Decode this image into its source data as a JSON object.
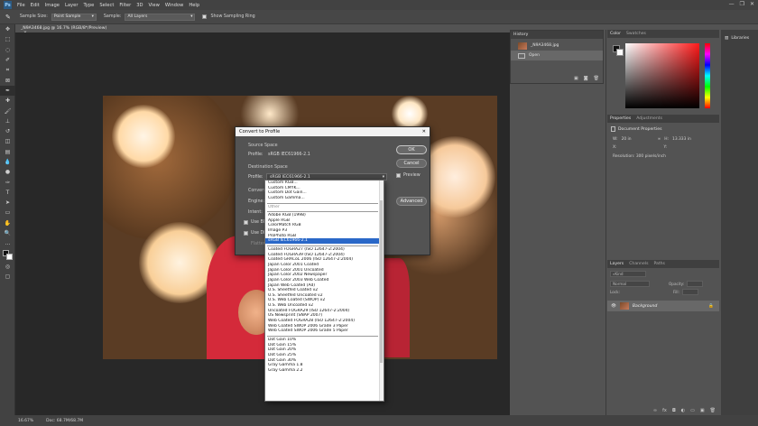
{
  "menubar": {
    "logo": "Ps",
    "items": [
      "File",
      "Edit",
      "Image",
      "Layer",
      "Type",
      "Select",
      "Filter",
      "3D",
      "View",
      "Window",
      "Help"
    ],
    "window_controls": [
      "—",
      "❐",
      "✕"
    ]
  },
  "options": {
    "sample_size_label": "Sample Size:",
    "sample_size_value": "Point Sample",
    "sample_label": "Sample:",
    "sample_value": "All Layers",
    "show_ring_label": "Show Sampling Ring"
  },
  "document": {
    "tab_title": "_N9A3468.jpg @ 16.7% (RGB/8*/Preview)",
    "tab_close": "×"
  },
  "status": {
    "zoom": "16.67%",
    "doc_info": "Doc: 68.7M/68.7M"
  },
  "history": {
    "tab": "History",
    "snapshot_name": "_N9A3468.jpg",
    "state": "Open"
  },
  "color_panel": {
    "tabs": [
      "Color",
      "Swatches"
    ]
  },
  "libraries": {
    "label": "Libraries"
  },
  "properties": {
    "tabs": [
      "Properties",
      "Adjustments"
    ],
    "heading": "Document Properties",
    "w_label": "W:",
    "w_value": "20 in",
    "h_label": "H:",
    "h_value": "13.333 in",
    "x_label": "X:",
    "y_label": "Y:",
    "resolution": "Resolution: 300 pixels/inch"
  },
  "layers": {
    "tabs": [
      "Layers",
      "Channels",
      "Paths"
    ],
    "kind_placeholder": "Kind",
    "blend_mode": "Normal",
    "opacity_label": "Opacity:",
    "lock_label": "Lock:",
    "fill_label": "Fill:",
    "layer_name": "Background"
  },
  "dialog": {
    "title": "Convert to Profile",
    "close": "✕",
    "source_space_label": "Source Space",
    "source_profile_label": "Profile:",
    "source_profile_value": "sRGB IEC61966-2.1",
    "destination_space_label": "Destination Space",
    "dest_profile_label": "Profile:",
    "dest_profile_value": "sRGB IEC61966-2.1",
    "conversion_label": "Convers",
    "engine_label": "Engine:",
    "intent_label": "Intent:",
    "use_bp_label": "Use Bl",
    "use_dither_label": "Use Di",
    "flatten_label": "Flatten",
    "ok": "OK",
    "cancel": "Cancel",
    "preview": "Preview",
    "advanced": "Advanced"
  },
  "dropdown": {
    "group1": [
      "Custom RGB...",
      "Custom CMYK...",
      "Custom Dot Gain...",
      "Custom Gamma..."
    ],
    "group2": [
      "Other"
    ],
    "group3": [
      "Adobe RGB (1998)",
      "Apple RGB",
      "ColorMatch RGB",
      "Image P3",
      "ProPhoto RGB",
      "sRGB IEC61966-2.1"
    ],
    "selected_index": 5,
    "group4": [
      "Coated FOGRA27 (ISO 12647-2:2004)",
      "Coated FOGRA39 (ISO 12647-2:2004)",
      "Coated GRACoL 2006 (ISO 12647-2:2004)",
      "Japan Color 2001 Coated",
      "Japan Color 2001 Uncoated",
      "Japan Color 2002 Newspaper",
      "Japan Color 2003 Web Coated",
      "Japan Web Coated (Ad)",
      "U.S. Sheetfed Coated v2",
      "U.S. Sheetfed Uncoated v2",
      "U.S. Web Coated (SWOP) v2",
      "U.S. Web Uncoated v2",
      "Uncoated FOGRA29 (ISO 12647-2:2004)",
      "US Newsprint (SNAP 2007)",
      "Web Coated FOGRA28 (ISO 12647-2:2004)",
      "Web Coated SWOP 2006 Grade 3 Paper",
      "Web Coated SWOP 2006 Grade 5 Paper"
    ],
    "group5": [
      "Dot Gain 10%",
      "Dot Gain 15%",
      "Dot Gain 20%",
      "Dot Gain 25%",
      "Dot Gain 30%",
      "Gray Gamma 1.8",
      "Gray Gamma 2.2"
    ]
  },
  "colors": {
    "selection": "#2a68c8",
    "panel_bg": "#535353",
    "workspace": "#282828"
  }
}
